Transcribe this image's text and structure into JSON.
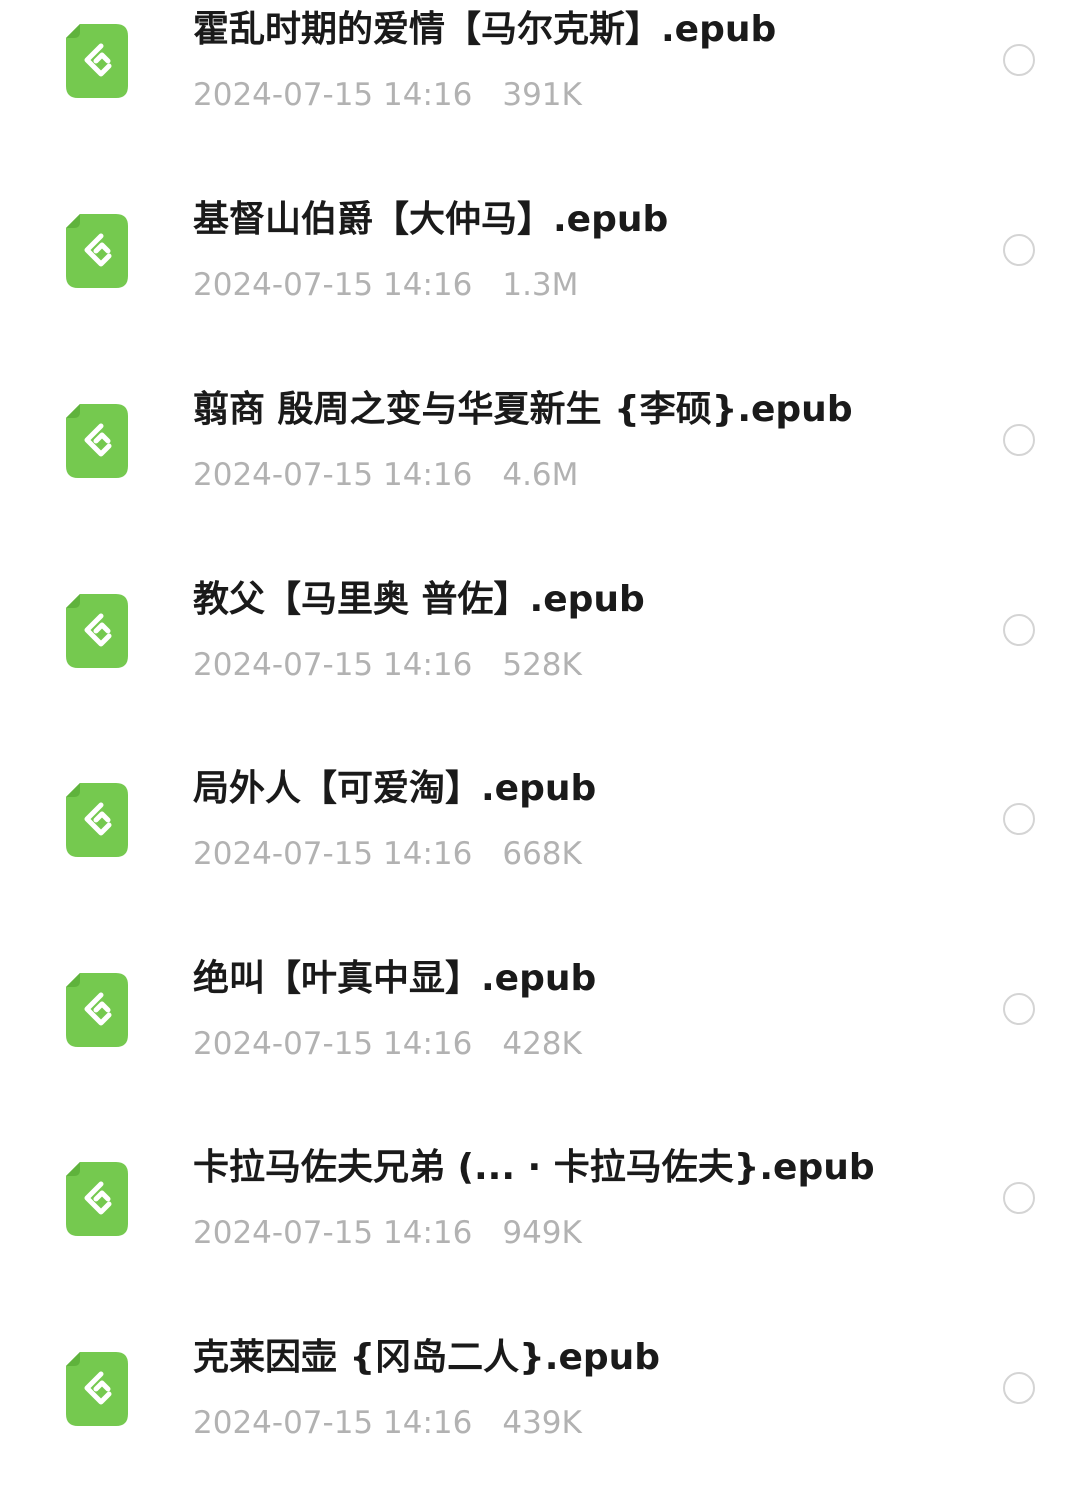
{
  "files": [
    {
      "name": "霍乱时期的爱情【马尔克斯】.epub",
      "date": "2024-07-15 14:16",
      "size": "391K",
      "icon": "epub-file-icon"
    },
    {
      "name": "基督山伯爵【大仲马】.epub",
      "date": "2024-07-15 14:16",
      "size": "1.3M",
      "icon": "epub-file-icon"
    },
    {
      "name": "翦商  殷周之变与华夏新生 {李硕}.epub",
      "date": "2024-07-15 14:16",
      "size": "4.6M",
      "icon": "epub-file-icon"
    },
    {
      "name": "教父【马里奥 普佐】.epub",
      "date": "2024-07-15 14:16",
      "size": "528K",
      "icon": "epub-file-icon"
    },
    {
      "name": "局外人【可爱淘】.epub",
      "date": "2024-07-15 14:16",
      "size": "668K",
      "icon": "epub-file-icon"
    },
    {
      "name": "绝叫【叶真中显】.epub",
      "date": "2024-07-15 14:16",
      "size": "428K",
      "icon": "epub-file-icon"
    },
    {
      "name": "卡拉马佐夫兄弟 (... · 卡拉马佐夫}.epub",
      "date": "2024-07-15 14:16",
      "size": "949K",
      "icon": "epub-file-icon"
    },
    {
      "name": "克莱因壶 {冈岛二人}.epub",
      "date": "2024-07-15 14:16",
      "size": "439K",
      "icon": "epub-file-icon"
    }
  ],
  "colors": {
    "icon_green": "#75c94f",
    "icon_fold": "#5fb33c",
    "name_text": "#1a1a1a",
    "meta_text": "#b2b2b2",
    "radio_border": "#d4d4d4"
  }
}
